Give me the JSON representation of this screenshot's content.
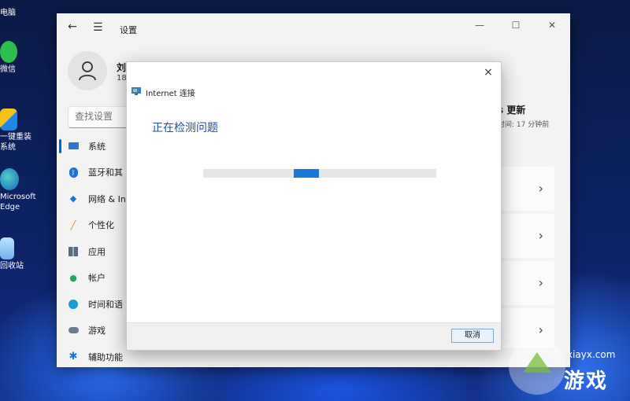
{
  "desktop": {
    "icons": [
      {
        "label": "电脑"
      },
      {
        "label": "微信"
      },
      {
        "label": "一键重装\n系统"
      },
      {
        "label": "Microsoft\nEdge"
      },
      {
        "label": "回收站"
      }
    ]
  },
  "settings": {
    "title": "设置",
    "user": {
      "name": "刘",
      "sub": "184"
    },
    "search_placeholder": "查找设置",
    "nav": [
      {
        "label": "系统",
        "icon": "monitor-icon",
        "active": true
      },
      {
        "label": "蓝牙和其",
        "icon": "bluetooth-icon"
      },
      {
        "label": "网络 & In",
        "icon": "wifi-icon"
      },
      {
        "label": "个性化",
        "icon": "brush-icon"
      },
      {
        "label": "应用",
        "icon": "apps-icon"
      },
      {
        "label": "帐户",
        "icon": "person-icon"
      },
      {
        "label": "时间和语",
        "icon": "clock-globe-icon"
      },
      {
        "label": "游戏",
        "icon": "gamepad-icon"
      },
      {
        "label": "辅助功能",
        "icon": "accessibility-icon"
      }
    ],
    "update": {
      "title": "s 更新",
      "sub": "时间: 17 分钟前"
    }
  },
  "dialog": {
    "title": "Internet 连接",
    "heading": "正在检测问题",
    "cancel_label": "取消",
    "close_label": "×"
  },
  "watermark": {
    "url": "xiayx.com",
    "text": "游戏"
  },
  "colors": {
    "accent": "#0067c0",
    "progress": "#1879d6",
    "heading": "#1f4e9e"
  }
}
